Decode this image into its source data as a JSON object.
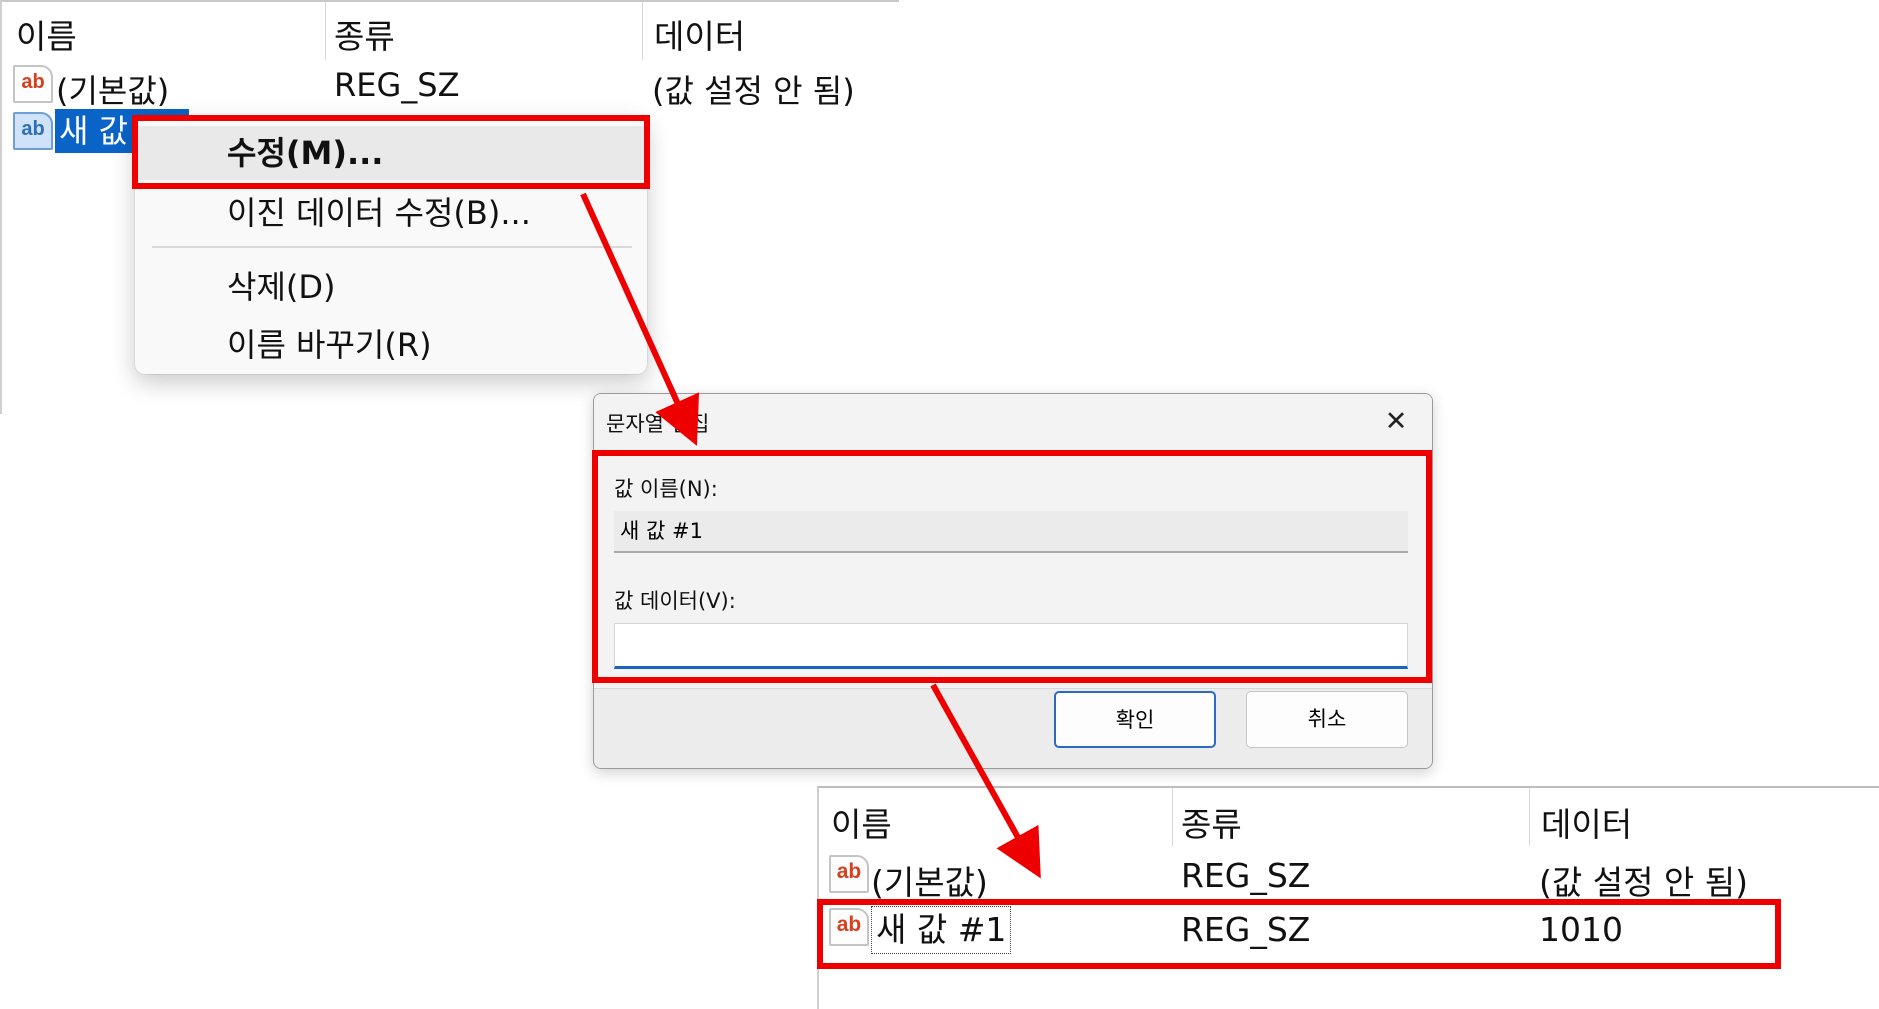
{
  "top_list": {
    "headers": [
      "이름",
      "종류",
      "데이터"
    ],
    "rows": [
      {
        "icon": "ab",
        "name": "(기본값)",
        "type": "REG_SZ",
        "data": "(값 설정 안 됨)"
      },
      {
        "icon": "ab",
        "name": "새 값",
        "type": "",
        "data": ""
      }
    ]
  },
  "context_menu": {
    "items": [
      {
        "label": "수정(M)..."
      },
      {
        "label": "이진 데이터 수정(B)..."
      },
      {
        "label": "삭제(D)"
      },
      {
        "label": "이름 바꾸기(R)"
      }
    ]
  },
  "dialog": {
    "title": "문자열 편집",
    "close_glyph": "✕",
    "value_name_label": "값 이름(N):",
    "value_name": "새 값 #1",
    "value_data_label": "값 데이터(V):",
    "value_data": "",
    "ok_label": "확인",
    "cancel_label": "취소"
  },
  "bottom_list": {
    "headers": [
      "이름",
      "종류",
      "데이터"
    ],
    "rows": [
      {
        "icon": "ab",
        "name": "(기본값)",
        "type": "REG_SZ",
        "data": "(값 설정 안 됨)"
      },
      {
        "icon": "ab",
        "name": "새 값 #1",
        "type": "REG_SZ",
        "data": "1010"
      }
    ]
  },
  "colors": {
    "highlight_red": "#ee0000",
    "selection_blue": "#0a64c8",
    "icon_text": "#d6401e",
    "focus_underline": "#1a64c0"
  }
}
